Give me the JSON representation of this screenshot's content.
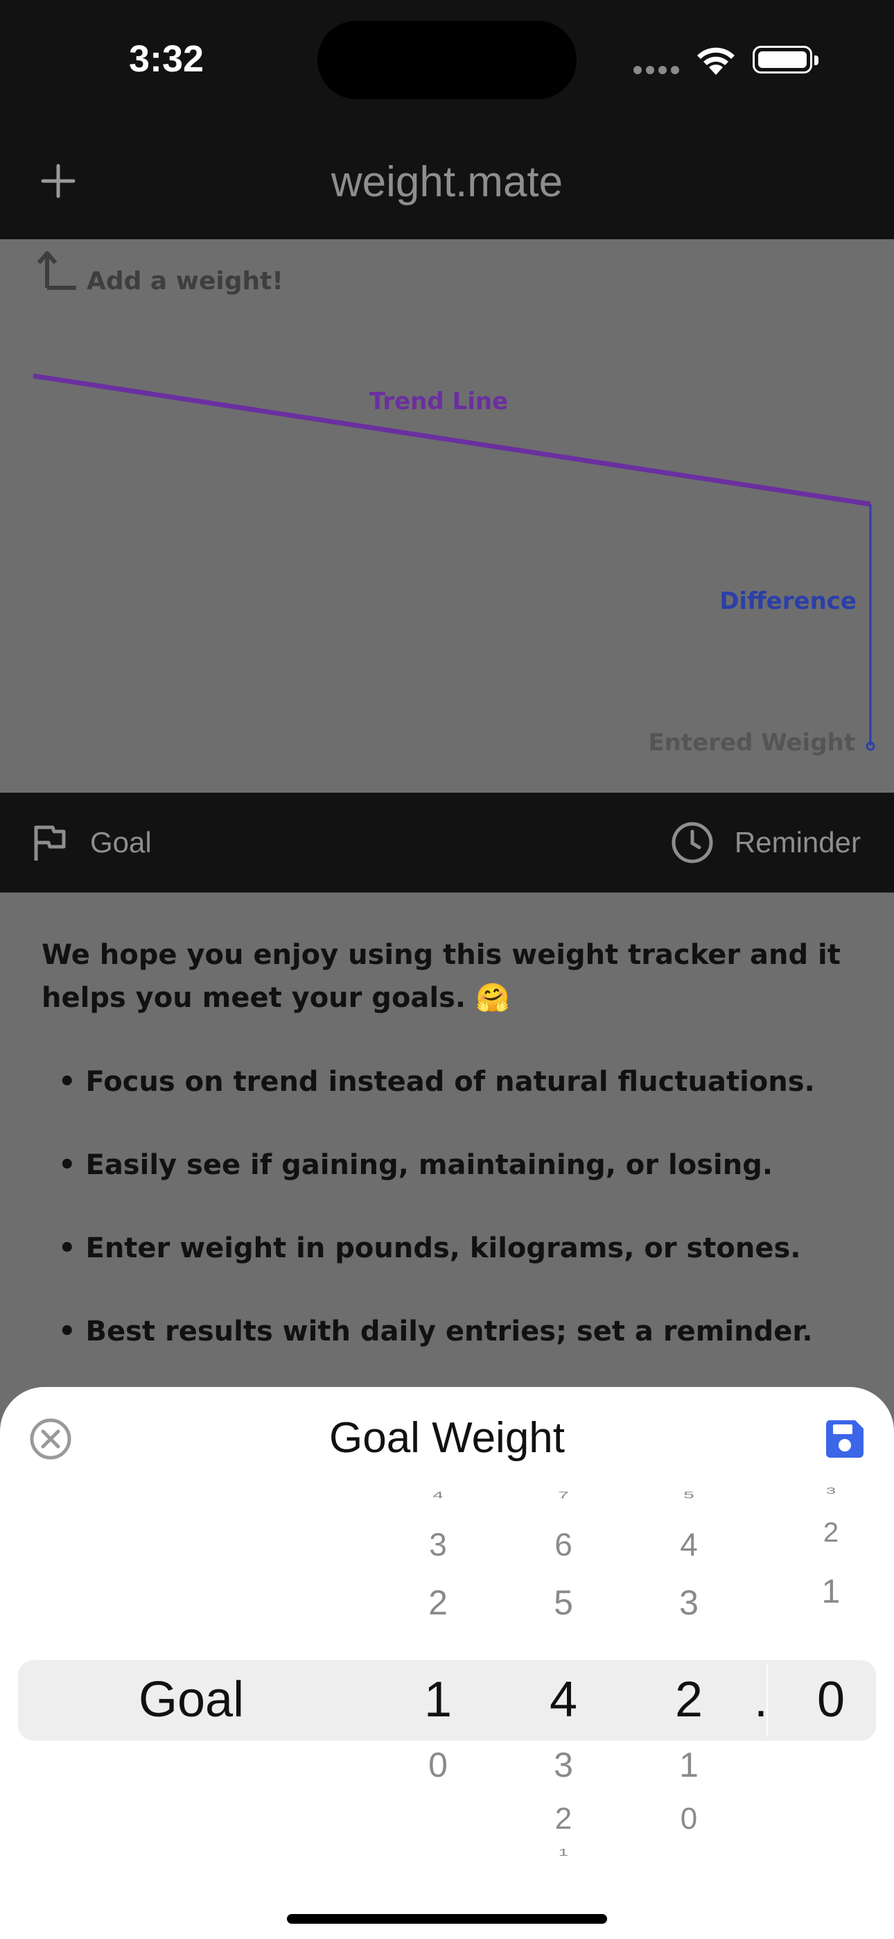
{
  "status_bar": {
    "time": "3:32"
  },
  "header": {
    "title": "weight.mate"
  },
  "chart_hint": {
    "add_weight": "Add a weight!",
    "trend_line_label": "Trend Line",
    "difference_label": "Difference",
    "entered_weight_label": "Entered Weight"
  },
  "tabs": {
    "goal": "Goal",
    "reminder": "Reminder"
  },
  "intro": {
    "text": "We hope you enjoy using this weight tracker and it helps you meet your goals. 🤗",
    "bullets": [
      "• Focus on trend instead of natural fluctuations.",
      "• Easily see if gaining, maintaining, or losing.",
      "• Enter weight in pounds, kilograms, or stones.",
      "• Best results with daily entries; set a reminder."
    ]
  },
  "sheet": {
    "title": "Goal Weight",
    "row_label": "Goal",
    "decimal_point": ".",
    "columns": [
      {
        "above": [
          "4",
          "3",
          "2"
        ],
        "selected": "1",
        "below": [
          "0"
        ]
      },
      {
        "above": [
          "7",
          "6",
          "5"
        ],
        "selected": "4",
        "below": [
          "3",
          "2",
          "1"
        ]
      },
      {
        "above": [
          "5",
          "4",
          "3"
        ],
        "selected": "2",
        "below": [
          "1",
          "0"
        ]
      },
      {
        "above": [
          "3",
          "2",
          "1"
        ],
        "selected": "0",
        "below": []
      }
    ]
  },
  "colors": {
    "trend": "#6a2fa0",
    "difference": "#2b3fa8",
    "accent": "#3b66e8"
  }
}
